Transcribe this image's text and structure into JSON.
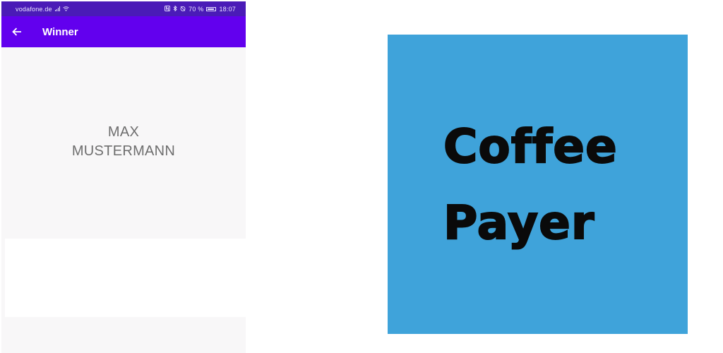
{
  "status_bar": {
    "carrier": "vodafone.de",
    "battery_percent": "70 %",
    "time": "18:07"
  },
  "app_bar": {
    "title": "Winner",
    "back_icon": "arrow-back-icon"
  },
  "winner": {
    "first_name": "MAX",
    "last_name": "MUSTERMANN"
  },
  "logo": {
    "line1": "Coffee",
    "line2": "Payer",
    "background": "#3fa3da"
  },
  "colors": {
    "status_bar": "#4a1bb7",
    "app_bar": "#6200ee",
    "screen_background": "#f8f7f8",
    "winner_text": "#6e6e6e"
  }
}
